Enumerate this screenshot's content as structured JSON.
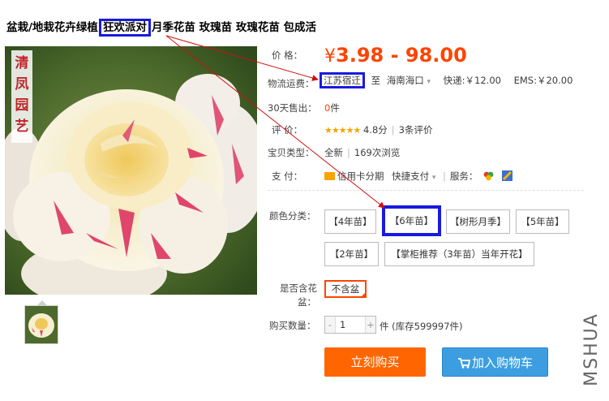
{
  "title": {
    "prefix": "盆栽/地栽花卉绿植",
    "highlight": "狂欢派对",
    "suffix": "月季花苗 玫瑰苗 玫瑰花苗 包成活"
  },
  "image": {
    "brand_chars": [
      "清",
      "凤",
      "园",
      "艺"
    ]
  },
  "price": {
    "label": "价 格：",
    "currency": "¥",
    "value": "3.98 - 98.00"
  },
  "shipping": {
    "label": "物流运费：",
    "from": "江苏宿迁",
    "to_word": "至",
    "to": "海南海口",
    "express": "快递:￥12.00",
    "ems": "EMS:￥20.00"
  },
  "sales": {
    "label": "30天售出：",
    "count": "0",
    "unit": "件"
  },
  "rating": {
    "label": "评 价：",
    "stars": "★★★★★",
    "score": "4.8分",
    "reviews": "3条评价"
  },
  "item_type": {
    "label": "宝贝类型：",
    "condition": "全新",
    "views": "169次浏览"
  },
  "payment": {
    "label": "支 付：",
    "credit": "信用卡分期",
    "quick": "快捷支付",
    "service": "服务："
  },
  "sku": {
    "label": "颜色分类：",
    "options": [
      "【4年苗】",
      "【6年苗】",
      "【树形月季】",
      "【5年苗】",
      "【2年苗】",
      "【掌柜推荐（3年苗）当年开花】"
    ]
  },
  "pot": {
    "label_line1": "是否含花",
    "label_line2": "盆：",
    "option": "不含盆"
  },
  "quantity": {
    "label": "购买数量：",
    "minus": "-",
    "value": "1",
    "plus": "+",
    "unit": "件",
    "stock": "(库存599997件)"
  },
  "buttons": {
    "buy": "立刻购买",
    "cart": "加入购物车"
  },
  "watermark": "MSHUA",
  "colors": {
    "price": "#ff4400",
    "annotation": "#1a1adf",
    "arrow": "#d01010",
    "buy": "#ff6600",
    "cart": "#3c9ee0"
  }
}
